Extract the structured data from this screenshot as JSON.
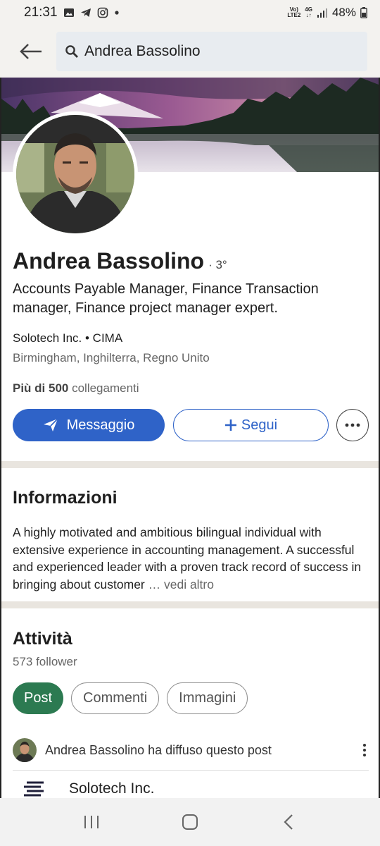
{
  "status": {
    "time": "21:31",
    "net_top": "Vo)",
    "net_bottom": "LTE2",
    "net_gen": "4G",
    "battery": "48%"
  },
  "search": {
    "value": "Andrea Bassolino"
  },
  "profile": {
    "name": "Andrea Bassolino",
    "degree": "· 3°",
    "headline": "Accounts Payable Manager, Finance Transaction manager, Finance project manager expert.",
    "company_line": "Solotech Inc. • CIMA",
    "location": "Birmingham, Inghilterra, Regno Unito",
    "connections_bold": "Più di 500",
    "connections_rest": " collegamenti"
  },
  "actions": {
    "message": "Messaggio",
    "follow": "Segui"
  },
  "about": {
    "title": "Informazioni",
    "text": "A highly motivated and ambitious bilingual individual with extensive experience in accounting management. A successful and experienced leader with a proven track record of success in bringing about customer",
    "see_more": " … vedi altro"
  },
  "activity": {
    "title": "Attività",
    "followers": "573 follower",
    "tabs": [
      "Post",
      "Commenti",
      "Immagini"
    ],
    "repost_name": "Andrea Bassolino",
    "repost_suffix": " ha diffuso questo post",
    "company": "Solotech Inc."
  },
  "colors": {
    "accent": "#2f63c8",
    "active_chip": "#2c7a51"
  }
}
